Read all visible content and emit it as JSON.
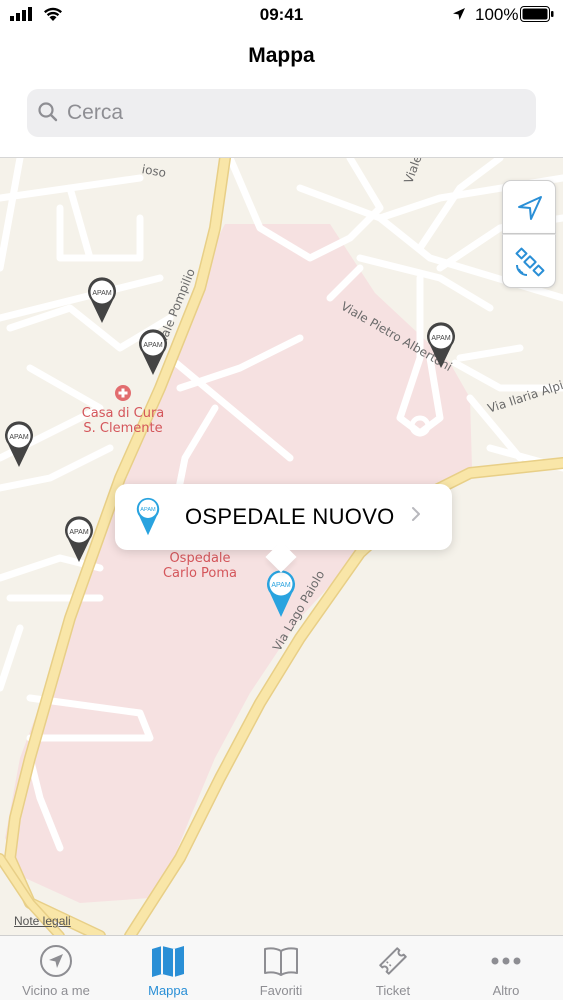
{
  "status_bar": {
    "time": "09:41",
    "battery_percent": "100%"
  },
  "nav": {
    "title": "Mappa"
  },
  "search": {
    "placeholder": "Cerca"
  },
  "map": {
    "pin_badge": "APAM",
    "poi_clinic": {
      "line1": "Casa di Cura",
      "line2": "S. Clemente"
    },
    "poi_hospital": {
      "line1": "Ospedale",
      "line2": "Carlo Poma"
    },
    "streets": {
      "viale_pompilio": "Viale Pompilio",
      "viale_pietro_albertoni": "Viale Pietro Albertoni",
      "via_ilaria_alpi": "Via Ilaria Alpi",
      "via_lago_paiolo": "Via Lago Paiolo",
      "viale_top": "Viale",
      "fragment": "ioso"
    },
    "legal_link": "Note legali",
    "callout": {
      "title": "OSPEDALE NUOVO"
    },
    "icons": {
      "locate": "location-arrow-icon",
      "satellite": "satellite-icon"
    }
  },
  "tabbar": {
    "tabs": [
      {
        "label": "Vicino a me",
        "icon": "compass-arrow-icon",
        "active": false
      },
      {
        "label": "Mappa",
        "icon": "map-icon",
        "active": true
      },
      {
        "label": "Favoriti",
        "icon": "book-icon",
        "active": false
      },
      {
        "label": "Ticket",
        "icon": "ticket-icon",
        "active": false
      },
      {
        "label": "Altro",
        "icon": "more-dots-icon",
        "active": false
      }
    ]
  },
  "colors": {
    "accent": "#2a8fd6",
    "pin_blue": "#29a3df",
    "pin_dark": "#444444",
    "hospital_area": "#f6e1e1",
    "road_major": "#f5d98a",
    "poi_label": "#d4565b"
  }
}
